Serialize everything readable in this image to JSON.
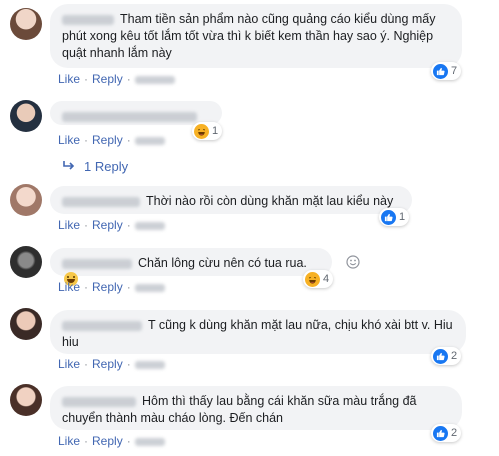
{
  "comments": [
    {
      "text": "Tham tiền sản phẩm nào cũng quảng cáo kiểu dùng mấy phút xong kêu tốt lắm tốt vừa thì k biết kem thần hay sao ý. Nghiệp quật nhanh lắm này",
      "actions": {
        "like": "Like",
        "reply": "Reply"
      },
      "reaction": {
        "type": "like",
        "count": "7"
      }
    },
    {
      "text": "",
      "actions": {
        "like": "Like",
        "reply": "Reply"
      },
      "reaction": {
        "type": "haha",
        "count": "1"
      },
      "replies_link": "1 Reply"
    },
    {
      "text": "Thời nào rồi còn dùng khăn mặt lau kiểu này",
      "actions": {
        "like": "Like",
        "reply": "Reply"
      },
      "reaction": {
        "type": "like",
        "count": "1"
      }
    },
    {
      "text": "Chăn lông cừu nên có tua rua.",
      "actions": {
        "like": "Like",
        "reply": "Reply"
      },
      "reaction": {
        "type": "haha",
        "count": "4"
      }
    },
    {
      "text": "T cũng k dùng khăn mặt lau nữa, chịu khó xài btt v. Hiu hiu",
      "actions": {
        "like": "Like",
        "reply": "Reply"
      },
      "reaction": {
        "type": "like",
        "count": "2"
      }
    },
    {
      "text": "Hôm thì thấy lau bằng cái khăn sữa màu trắng đã chuyển thành màu cháo lòng. Đến chán",
      "actions": {
        "like": "Like",
        "reply": "Reply"
      },
      "reaction": {
        "type": "like",
        "count": "2"
      }
    }
  ],
  "colors": {
    "link": "#4267b2",
    "bubble": "#f2f3f5",
    "like": "#1877f2",
    "haha": "#f7b125"
  }
}
